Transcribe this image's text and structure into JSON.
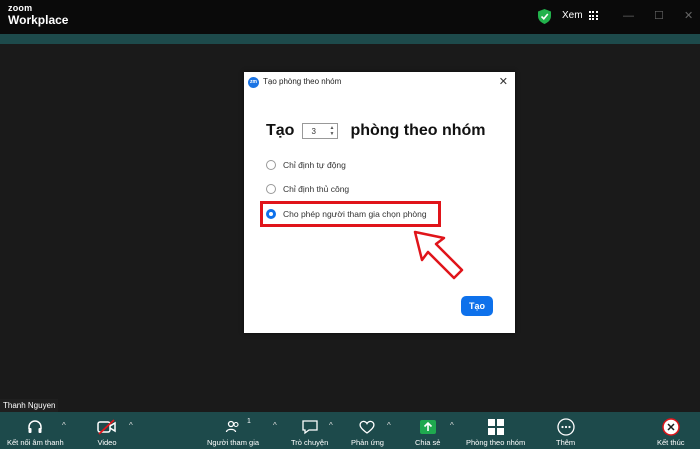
{
  "app": {
    "brand_top": "zoom",
    "brand_bottom": "Workplace"
  },
  "titlebar": {
    "view_label": "Xem",
    "minimize": "—",
    "maximize": "☐",
    "close": "✕"
  },
  "dialog": {
    "title": "Tạo phòng theo nhóm",
    "close": "✕",
    "heading_prefix": "Tạo",
    "heading_suffix": "phòng theo nhóm",
    "room_count": "3",
    "options": [
      {
        "label": "Chỉ định tự động",
        "selected": false
      },
      {
        "label": "Chỉ định thủ công",
        "selected": false
      },
      {
        "label": "Cho phép người tham gia chọn phòng",
        "selected": true
      }
    ],
    "create_button": "Tạo"
  },
  "participant_name": "Thanh Nguyen",
  "toolbar": {
    "audio": "Kết nối âm thanh",
    "video": "Video",
    "participants": "Người tham gia",
    "participants_count": "1",
    "chat": "Trò chuyện",
    "reactions": "Phản ứng",
    "share": "Chia sẻ",
    "breakout": "Phòng theo nhóm",
    "more": "Thêm",
    "end": "Kết thúc"
  },
  "colors": {
    "accent": "#0e71eb",
    "toolbar_bg": "#1d4a4b",
    "highlight": "#e0141a",
    "share_green": "#1fa94f",
    "shield_green": "#22b24c"
  }
}
